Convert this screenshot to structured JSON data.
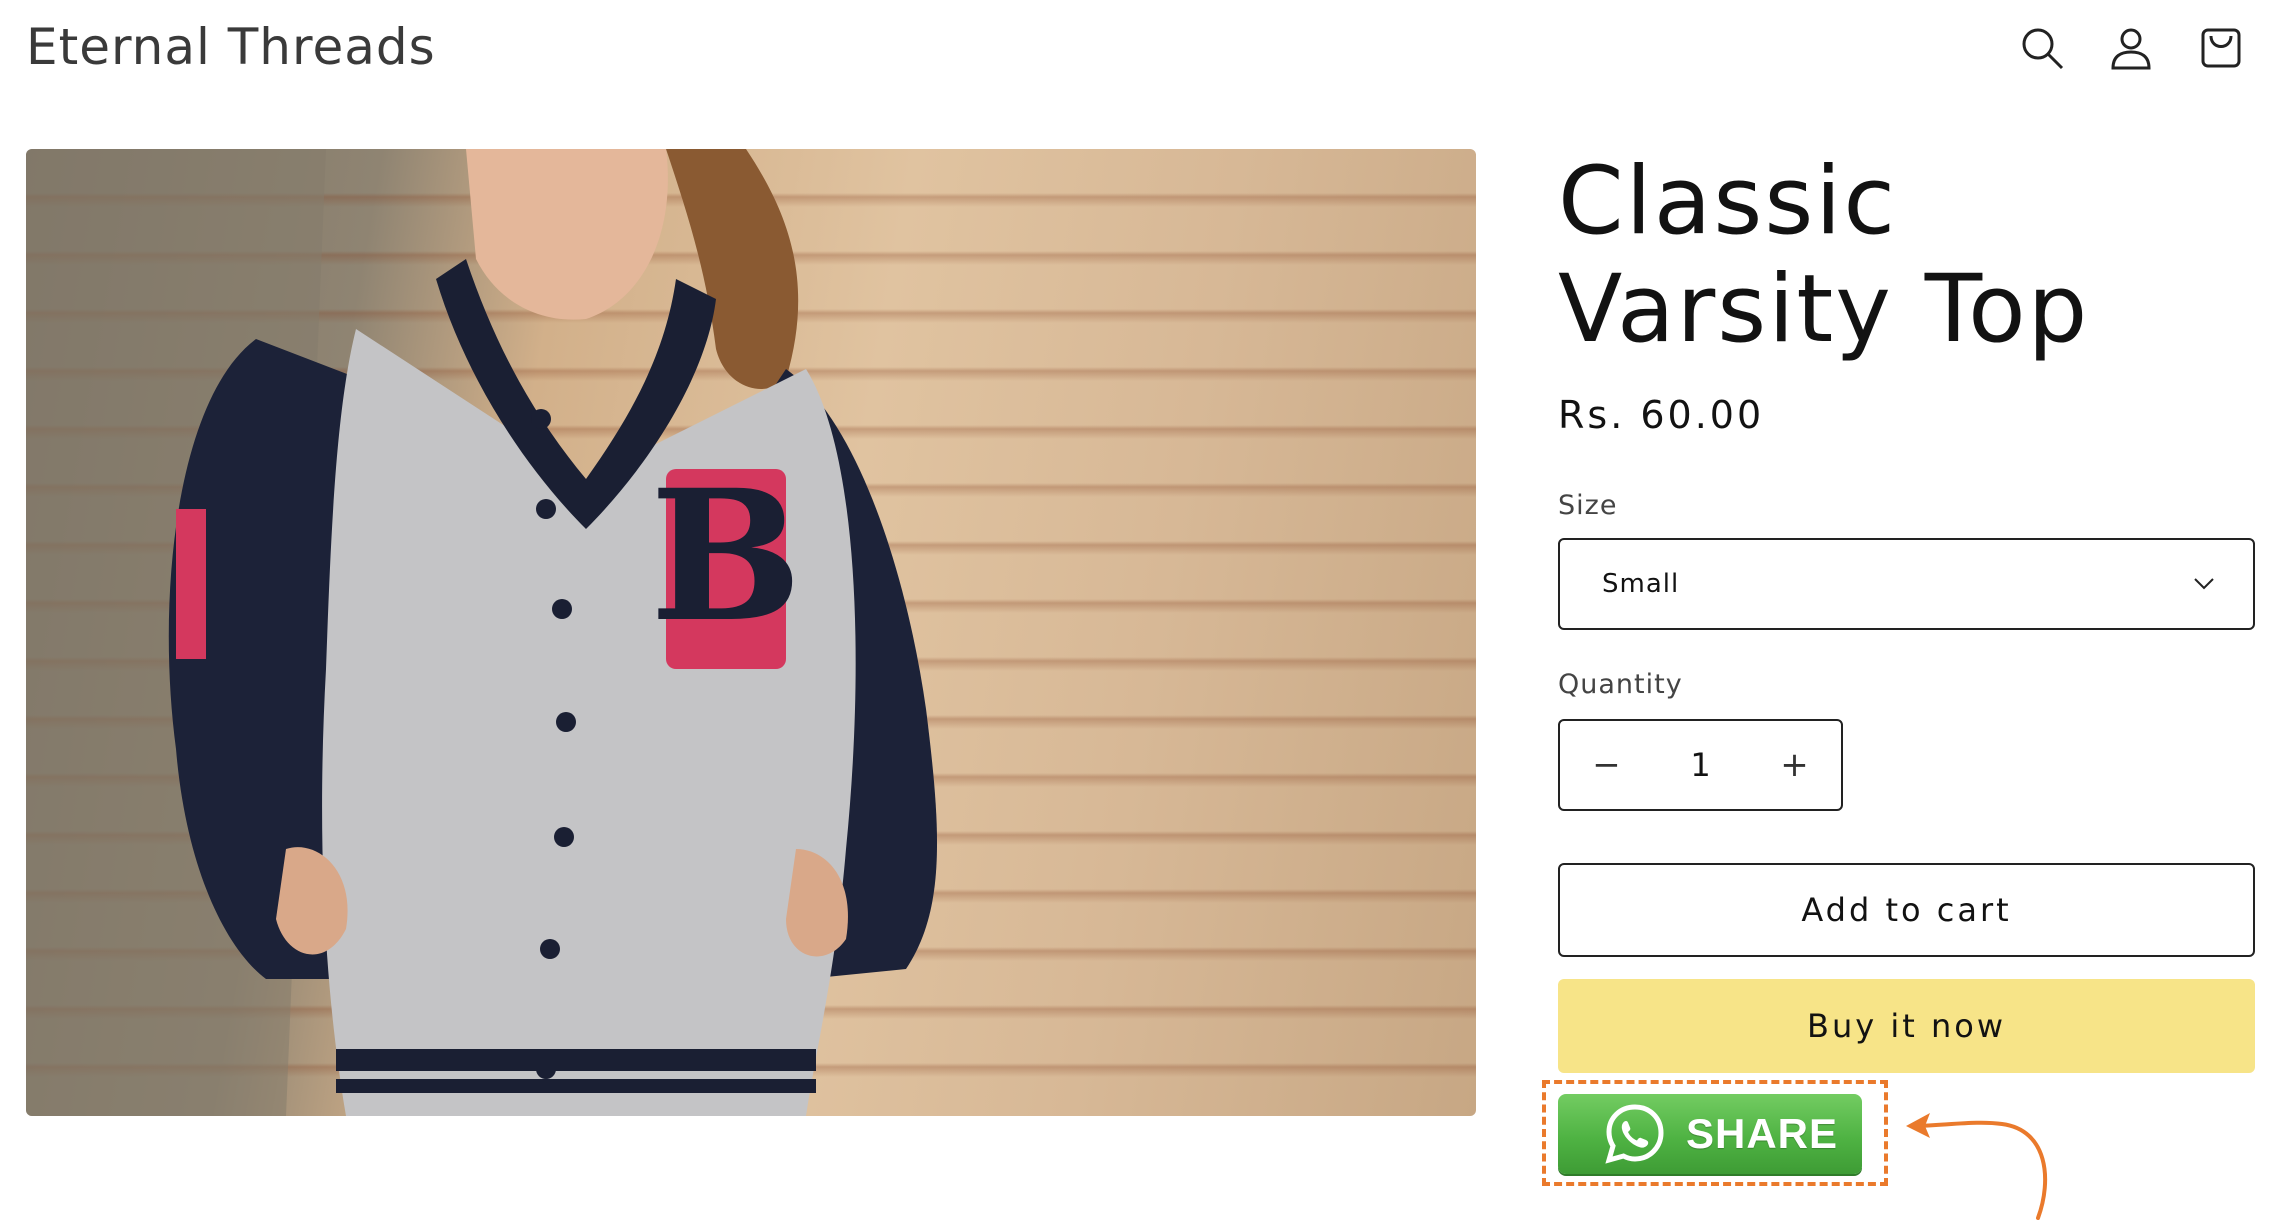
{
  "header": {
    "store_name": "Eternal Threads",
    "icons": [
      "search-icon",
      "account-icon",
      "cart-icon"
    ]
  },
  "product": {
    "title": "Classic Varsity Top",
    "price": "Rs. 60.00",
    "image_alt": "Woman wearing grey varsity jacket with navy sleeves and red B patch"
  },
  "size": {
    "label": "Size",
    "selected": "Small"
  },
  "quantity": {
    "label": "Quantity",
    "value": "1",
    "minus": "−",
    "plus": "+"
  },
  "actions": {
    "add_to_cart": "Add to cart",
    "buy_now": "Buy it now",
    "share": "SHARE"
  },
  "colors": {
    "buy_now_bg": "#f7e488",
    "share_green": "#4fb343",
    "highlight_orange": "#ea7a2c"
  }
}
